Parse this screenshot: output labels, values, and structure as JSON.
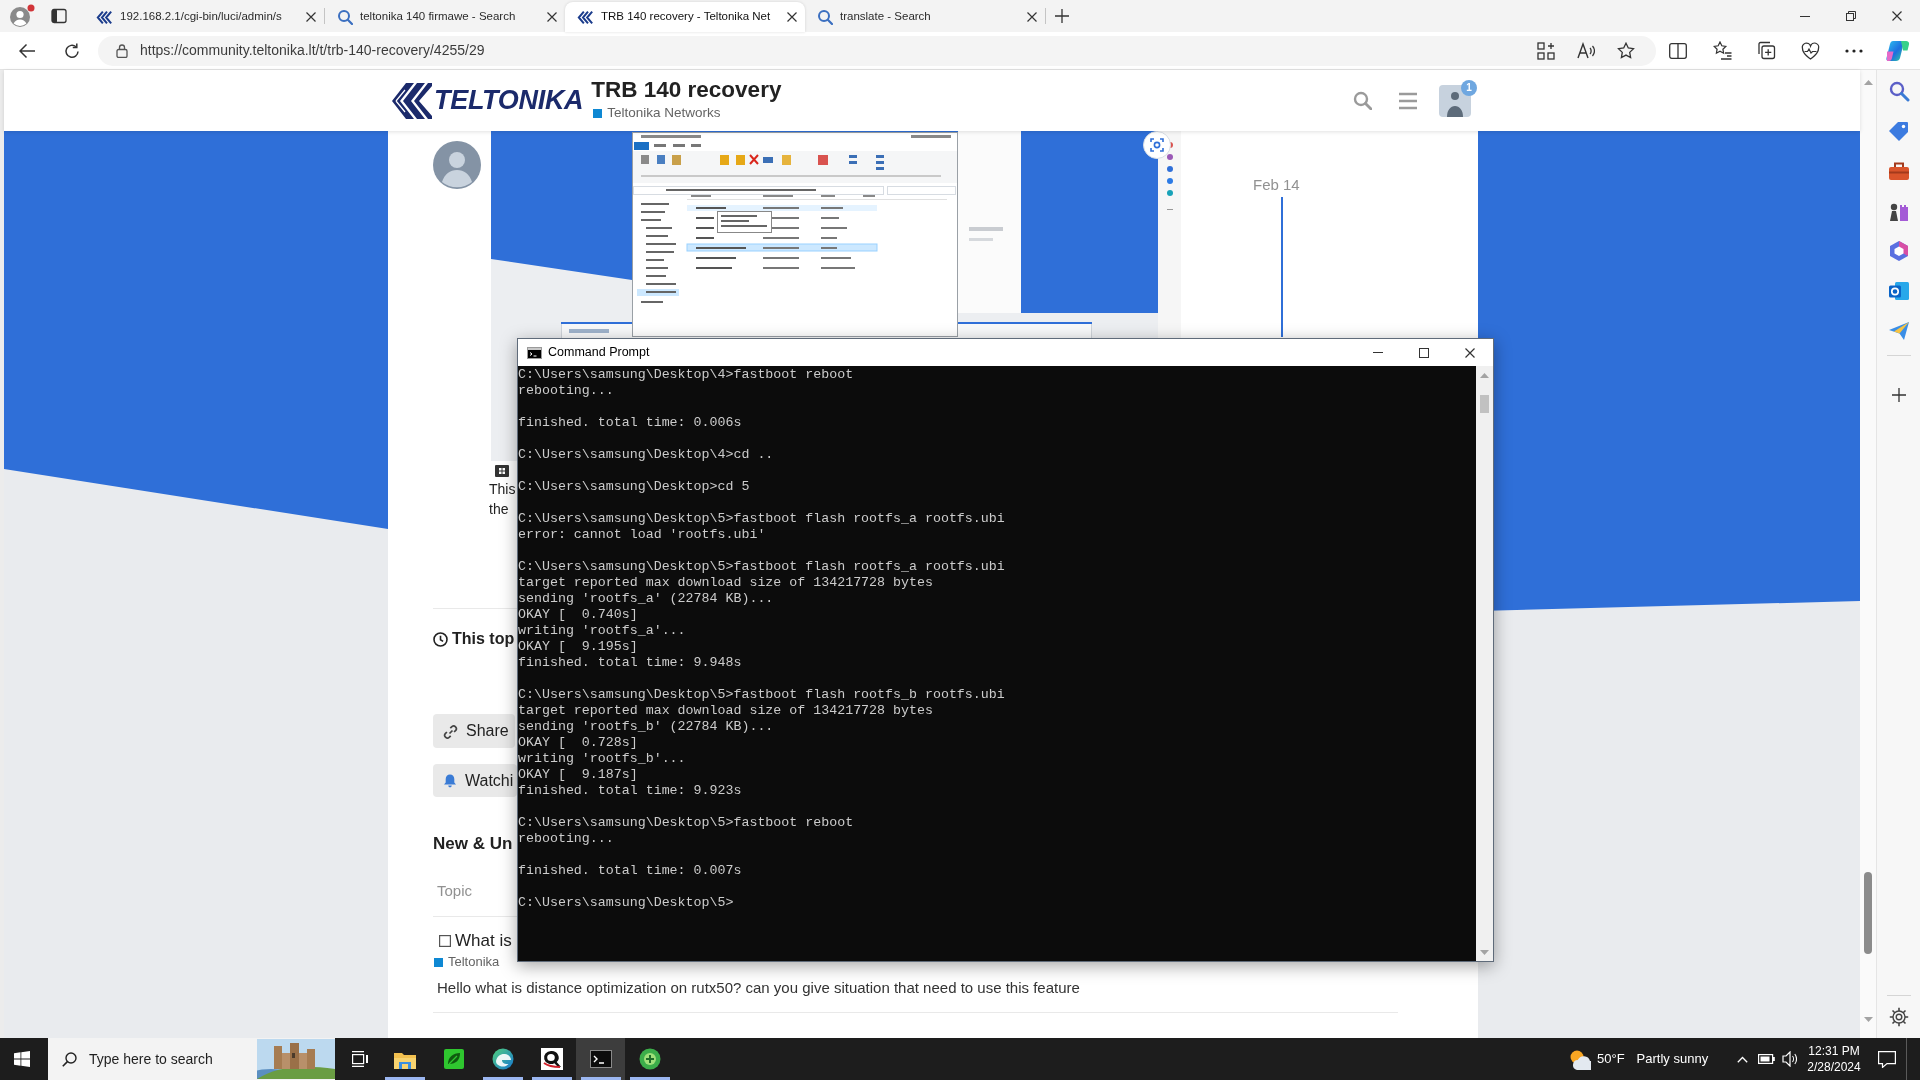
{
  "browser": {
    "tabs": [
      {
        "kind": "site",
        "title": "192.168.2.1/cgi-bin/luci/admin/s",
        "selected": false
      },
      {
        "kind": "search",
        "title": "teltonika 140 firmawe - Search",
        "selected": false
      },
      {
        "kind": "site",
        "title": "TRB 140 recovery - Teltonika Net",
        "selected": true
      },
      {
        "kind": "search",
        "title": "translate - Search",
        "selected": false
      }
    ],
    "url": "https://community.teltonika.lt/t/trb-140-recovery/4255/29"
  },
  "site_header": {
    "logo": "TELTONIKA",
    "title": "TRB 140 recovery",
    "category": {
      "name": "Teltonika Networks",
      "color": "#0e88d3"
    },
    "notification_count": "1"
  },
  "post": {
    "text_lines": [
      "This",
      "the"
    ]
  },
  "timeline": {
    "date": "Feb 14"
  },
  "topic_footer": {
    "heading": "This top",
    "buttons": [
      {
        "kind": "share",
        "label": "Share"
      },
      {
        "kind": "watch",
        "label": "Watchi"
      }
    ]
  },
  "suggested": {
    "heading": "New & Un",
    "columns": [
      "Topic"
    ],
    "topics": [
      {
        "title": "What is",
        "category": {
          "name": "Teltonika",
          "color": "#0e88d3"
        },
        "excerpt": "Hello what is distance optimization on rutx50? can you give situation that need to use this feature"
      }
    ]
  },
  "command_prompt": {
    "title": "Command Prompt",
    "blocks": [
      [
        "C:\\Users\\samsung\\Desktop\\4>fastboot reboot",
        "rebooting..."
      ],
      [
        "finished. total time: 0.006s"
      ],
      [
        "C:\\Users\\samsung\\Desktop\\4>cd .."
      ],
      [
        "C:\\Users\\samsung\\Desktop>cd 5"
      ],
      [
        "C:\\Users\\samsung\\Desktop\\5>fastboot flash rootfs_a rootfs.ubi",
        "error: cannot load 'rootfs.ubi'"
      ],
      [
        "C:\\Users\\samsung\\Desktop\\5>fastboot flash rootfs_a rootfs.ubi",
        "target reported max download size of 134217728 bytes",
        "sending 'rootfs_a' (22784 KB)...",
        "OKAY [  0.740s]",
        "writing 'rootfs_a'...",
        "OKAY [  9.195s]",
        "finished. total time: 9.948s"
      ],
      [
        "C:\\Users\\samsung\\Desktop\\5>fastboot flash rootfs_b rootfs.ubi",
        "target reported max download size of 134217728 bytes",
        "sending 'rootfs_b' (22784 KB)...",
        "OKAY [  0.728s]",
        "writing 'rootfs_b'...",
        "OKAY [  9.187s]",
        "finished. total time: 9.923s"
      ],
      [
        "C:\\Users\\samsung\\Desktop\\5>fastboot reboot",
        "rebooting..."
      ],
      [
        "finished. total time: 0.007s"
      ],
      [
        "C:\\Users\\samsung\\Desktop\\5>"
      ]
    ]
  },
  "taskbar": {
    "search": {
      "placeholder": "Type here to search"
    },
    "apps": [
      {
        "running": true,
        "active": false
      },
      {
        "running": false,
        "active": false
      },
      {
        "running": true,
        "active": false
      },
      {
        "running": true,
        "active": false
      },
      {
        "running": true,
        "active": true
      },
      {
        "running": true,
        "active": false
      }
    ],
    "weather": {
      "temperature": "50°F",
      "condition": "Partly sunny"
    },
    "clock": {
      "time": "12:31 PM",
      "date": "2/28/2024"
    }
  }
}
